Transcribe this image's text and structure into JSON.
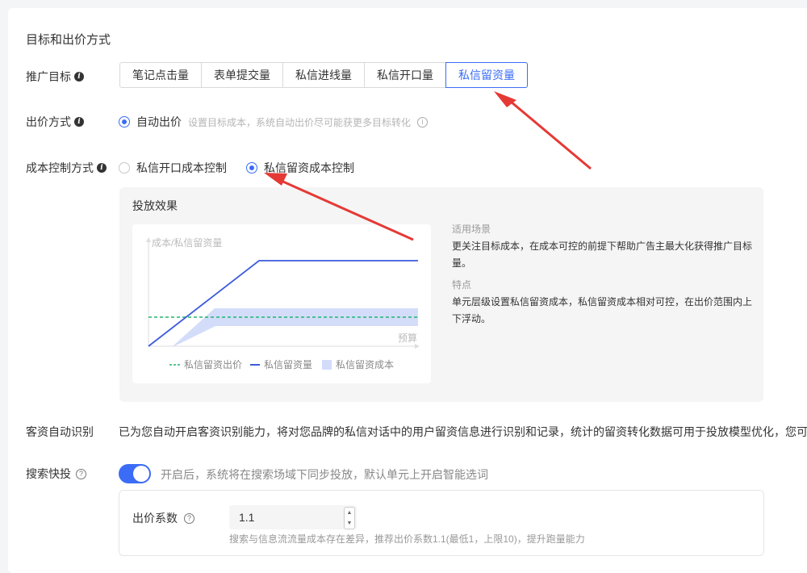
{
  "section": {
    "title": "目标和出价方式"
  },
  "promotion": {
    "label": "推广目标",
    "options": [
      "笔记点击量",
      "表单提交量",
      "私信进线量",
      "私信开口量",
      "私信留资量"
    ],
    "selected_index": 4
  },
  "bidding": {
    "label": "出价方式",
    "option": "自动出价",
    "hint": "设置目标成本，系统自动出价尽可能获更多目标转化"
  },
  "cost_control": {
    "label": "成本控制方式",
    "options": [
      "私信开口成本控制",
      "私信留资成本控制"
    ],
    "selected_index": 1
  },
  "effect": {
    "title": "投放效果",
    "scene_title": "适用场景",
    "scene_text": "更关注目标成本，在成本可控的前提下帮助广告主最大化获得推广目标量。",
    "feature_title": "特点",
    "feature_text": "单元层级设置私信留资成本，私信留资成本相对可控，在出价范围内上下浮动。"
  },
  "chart_data": {
    "type": "line",
    "ylabel": "成本/私信留资量",
    "xlabel": "预算",
    "legend": [
      "私信留资出价",
      "私信留资量",
      "私信留资成本"
    ],
    "legend_position": "bottom",
    "colors": {
      "bid": "#20b56e",
      "volume": "#3b5bdb",
      "cost": "#d3ddfa"
    }
  },
  "customer_identify": {
    "label": "客资自动识别",
    "text": "已为您自动开启客资识别能力，将对您品牌的私信对话中的用户留资信息进行识别和记录，统计的留资转化数据可用于投放模型优化，您可"
  },
  "search": {
    "label": "搜索快投",
    "toggle_on": true,
    "hint": "开启后，系统将在搜索场域下同步投放，默认单元上开启智能选词",
    "coef_label": "出价系数",
    "coef_value": "1.1",
    "note": "搜索与信息流流量成本存在差异，推荐出价系数1.1(最低1，上限10)，提升跑量能力"
  },
  "colors": {
    "accent": "#3b6cf6",
    "arrow": "#e53935"
  }
}
